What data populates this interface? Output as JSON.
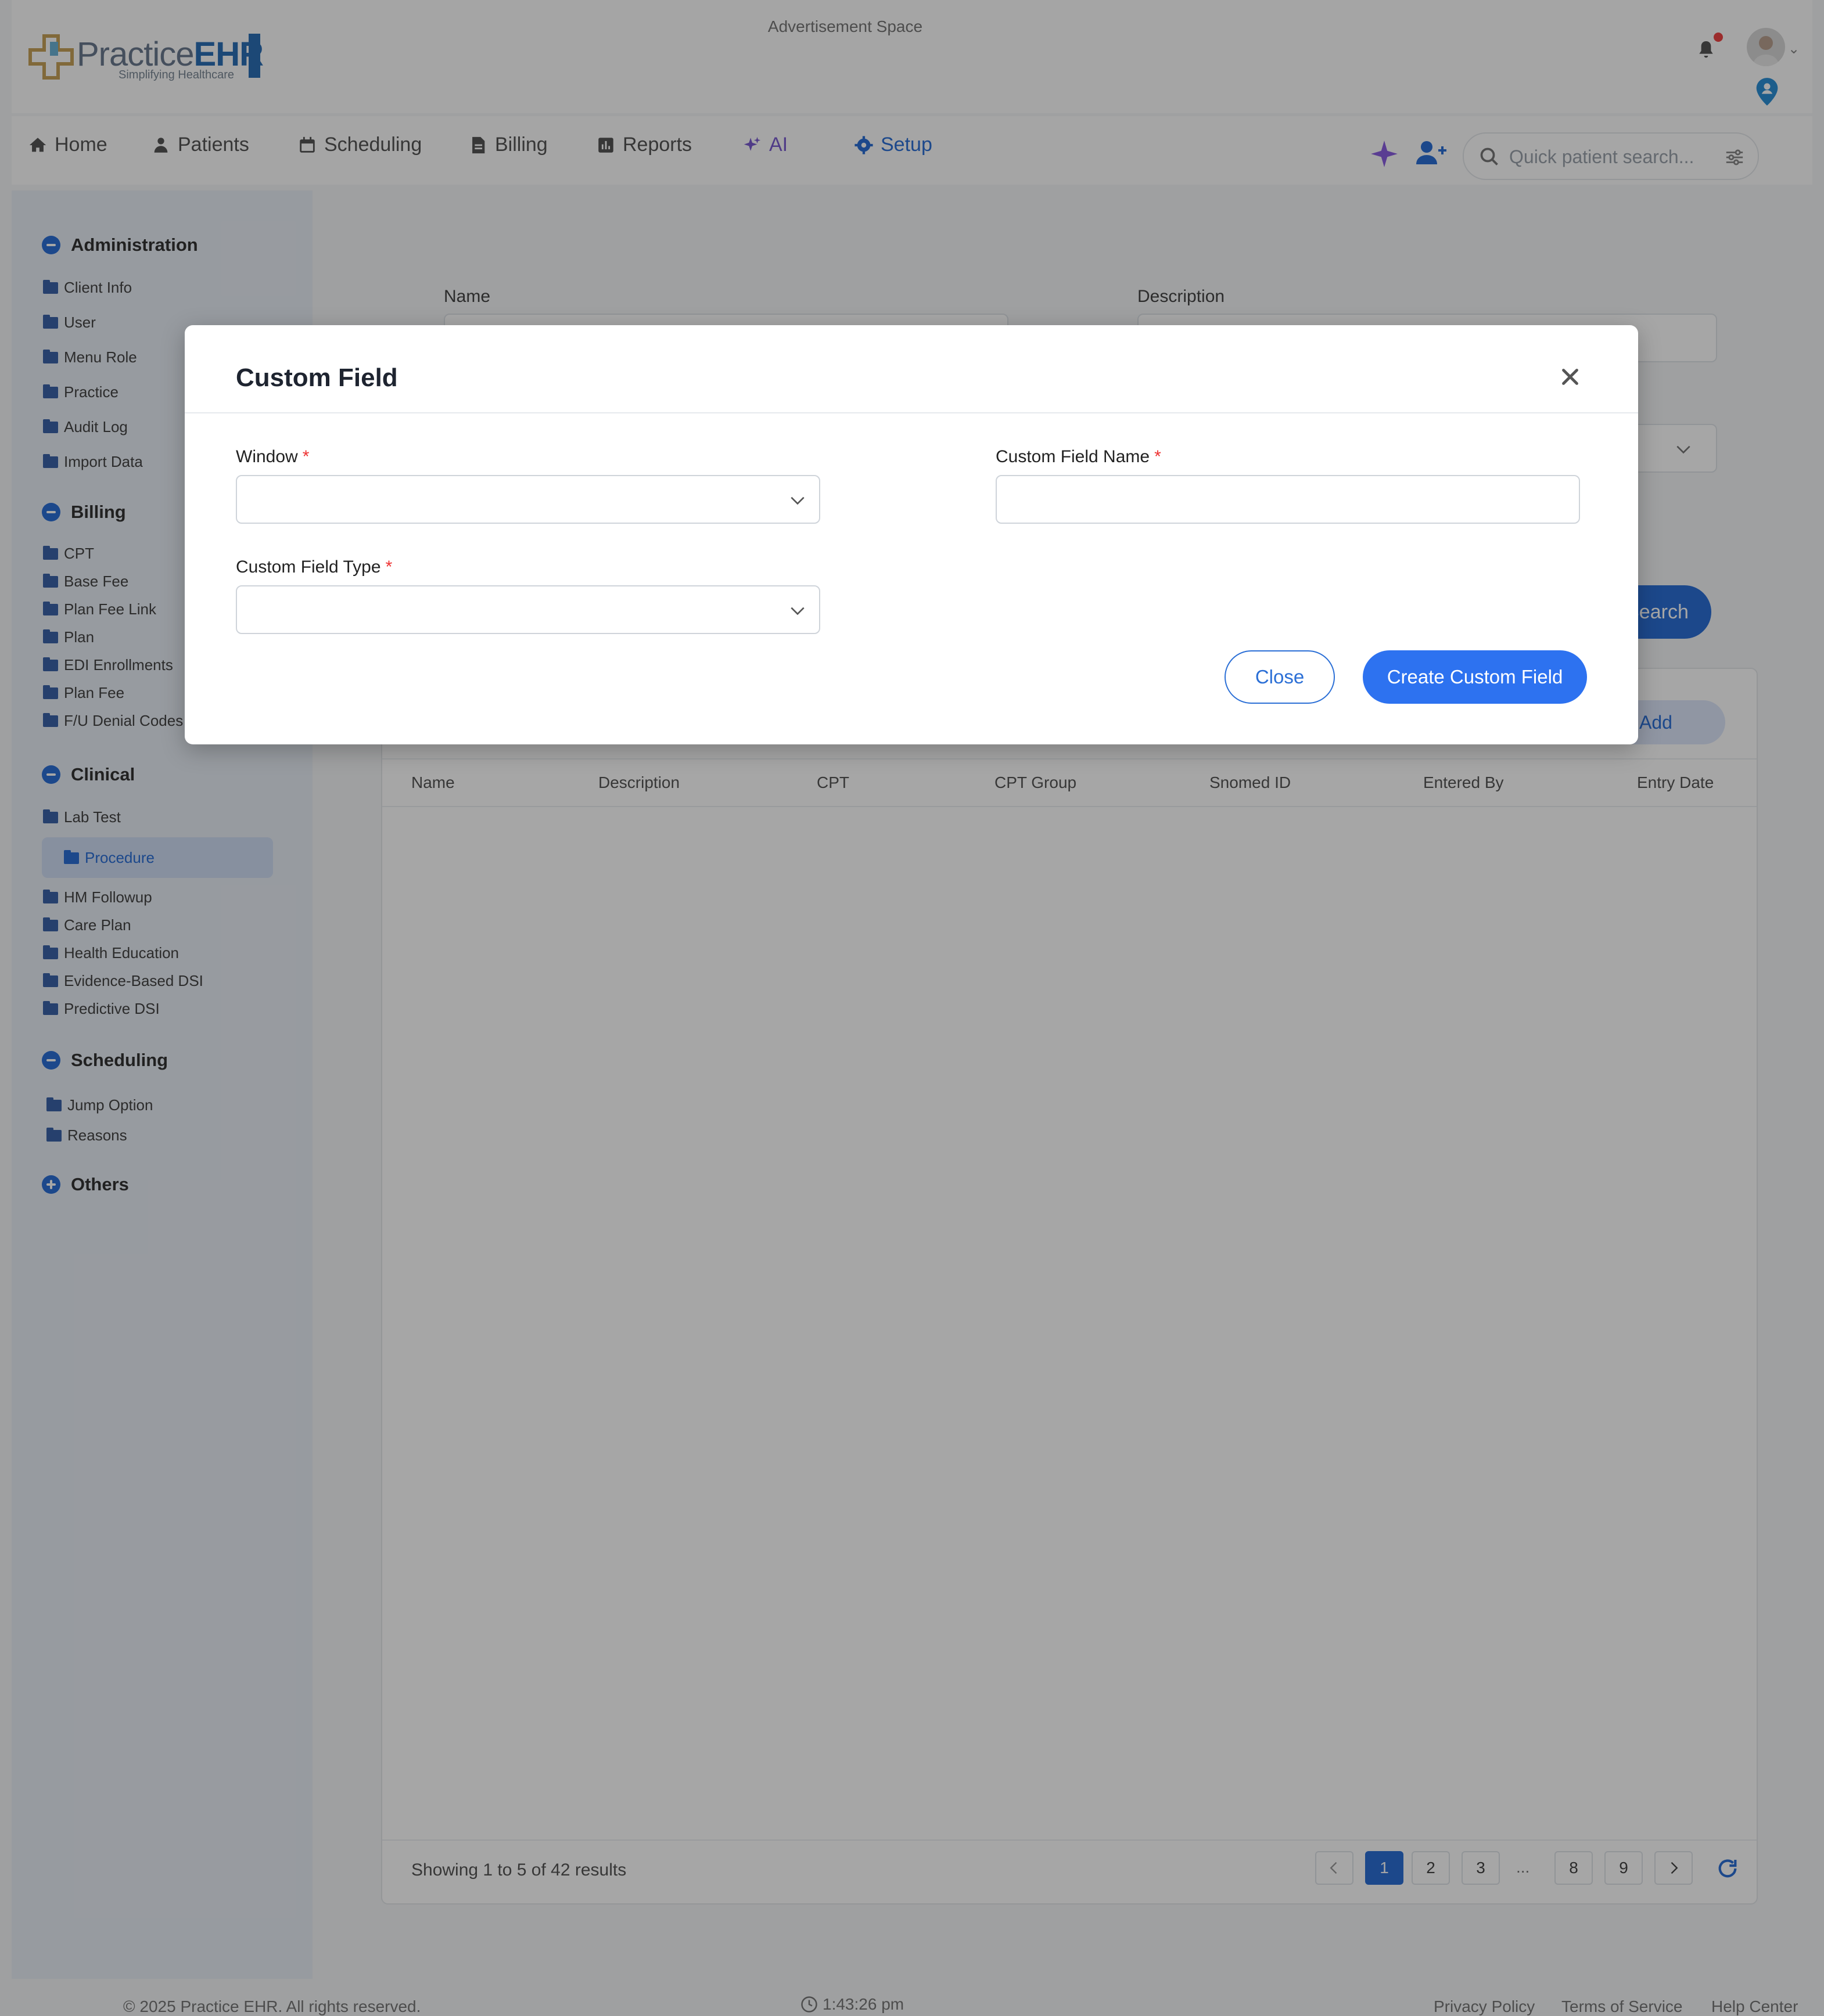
{
  "header": {
    "logo_main": "Practice",
    "logo_accent": "EHR",
    "logo_tagline": "Simplifying Healthcare",
    "ad_space": "Advertisement Space"
  },
  "nav": {
    "items": [
      {
        "label": "Home",
        "icon": "home-icon"
      },
      {
        "label": "Patients",
        "icon": "patients-icon"
      },
      {
        "label": "Scheduling",
        "icon": "calendar-icon"
      },
      {
        "label": "Billing",
        "icon": "document-icon"
      },
      {
        "label": "Reports",
        "icon": "chart-icon"
      },
      {
        "label": "AI",
        "icon": "sparkle-icon"
      },
      {
        "label": "Setup",
        "icon": "gear-icon"
      }
    ],
    "quick_search_placeholder": "Quick patient search..."
  },
  "sidebar": {
    "sections": [
      {
        "title": "Administration",
        "items": [
          "Client Info",
          "User",
          "Menu Role",
          "Practice",
          "Audit Log",
          "Import Data"
        ]
      },
      {
        "title": "Billing",
        "items": [
          "CPT",
          "Base Fee",
          "Plan Fee Link",
          "Plan",
          "EDI Enrollments",
          "Plan Fee",
          "F/U Denial Codes"
        ]
      },
      {
        "title": "Clinical",
        "items": [
          "Lab Test",
          "Procedure",
          "HM Followup",
          "Care Plan",
          "Health Education",
          "Evidence-Based DSI",
          "Predictive DSI"
        ]
      },
      {
        "title": "Scheduling",
        "items": [
          "Jump Option",
          "Reasons"
        ]
      },
      {
        "title": "Others",
        "items": []
      }
    ],
    "active_item": "Procedure"
  },
  "main": {
    "filters": {
      "name_label": "Name",
      "description_label": "Description"
    },
    "search_button": "Search",
    "add_button": "Add Procedure",
    "table": {
      "columns": [
        "Name",
        "Description",
        "CPT",
        "CPT Group",
        "Snomed ID",
        "Entered By",
        "Entry Date"
      ],
      "rows": []
    },
    "pagination": {
      "showing": "Showing 1 to 5 of 42 results",
      "pages": [
        "1",
        "2",
        "3",
        "8",
        "9"
      ],
      "ellipsis": "...",
      "current": "1"
    }
  },
  "footer": {
    "copyright": "© 2025 Practice EHR. All rights reserved.",
    "clock": "1:43:26 pm",
    "links": [
      "Privacy Policy",
      "Terms of Service",
      "Help Center"
    ]
  },
  "modal": {
    "title": "Custom Field",
    "window_label": "Window",
    "name_label": "Custom Field Name",
    "type_label": "Custom Field Type",
    "required_mark": "*",
    "window_value": "",
    "name_value": "",
    "type_value": "",
    "close_button": "Close",
    "create_button": "Create Custom Field"
  },
  "colors": {
    "primary": "#2d72f0",
    "required": "#ee3333",
    "ai": "#7a5bd0"
  }
}
